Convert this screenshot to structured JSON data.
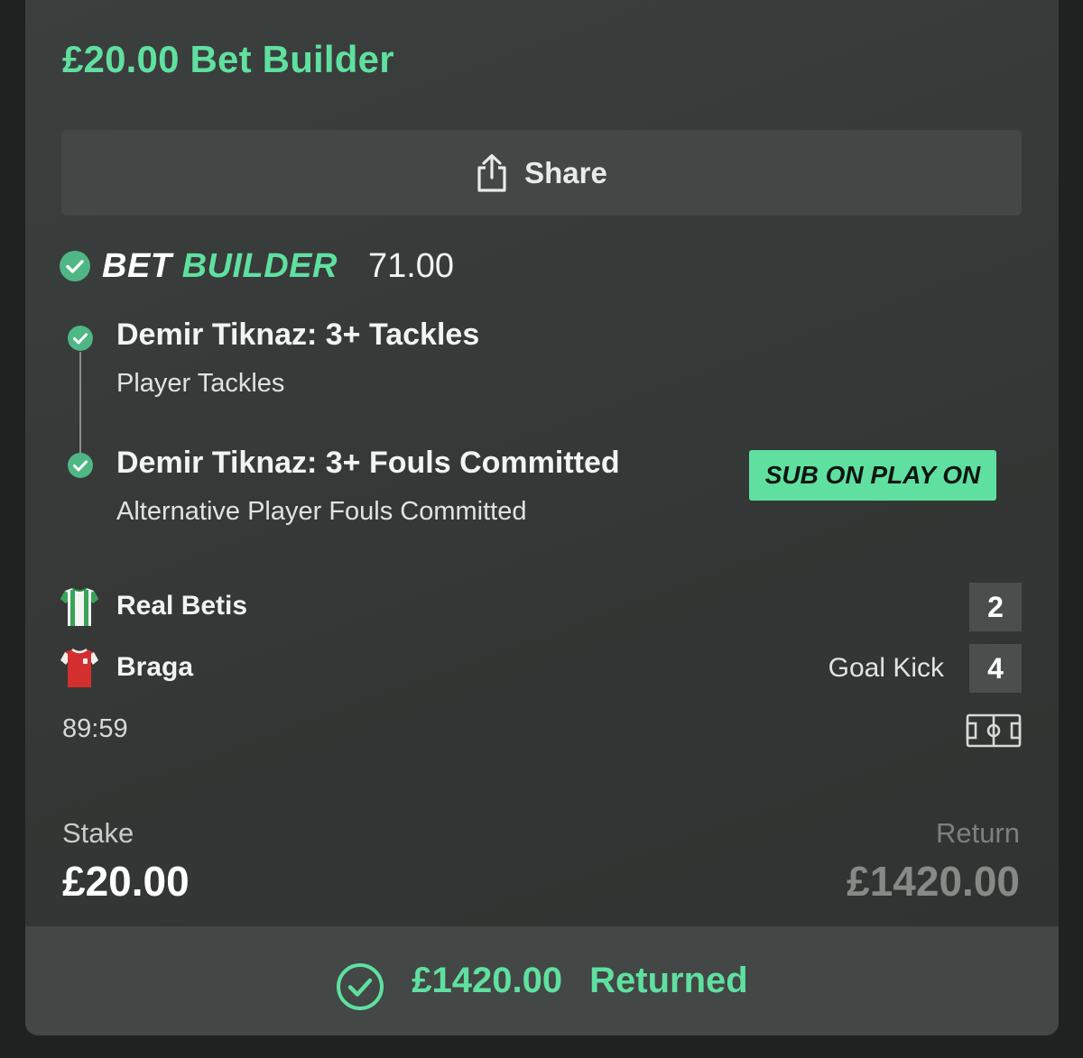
{
  "bet": {
    "title": "£20.00 Bet Builder",
    "share_label": "Share",
    "builder_logo_part1": "BET",
    "builder_logo_part2": "BUILDER",
    "odds": "71.00",
    "promo_badge": "SUB ON PLAY ON"
  },
  "legs": [
    {
      "title": "Demir Tiknaz: 3+ Tackles",
      "market": "Player Tackles"
    },
    {
      "title": "Demir Tiknaz: 3+ Fouls Committed",
      "market": "Alternative Player Fouls Committed"
    }
  ],
  "match": {
    "home": {
      "name": "Real Betis",
      "score": "2",
      "shirt_icon": "green-white-striped-shirt-icon"
    },
    "away": {
      "name": "Braga",
      "score": "4",
      "shirt_icon": "red-shirt-icon",
      "event": "Goal Kick"
    },
    "clock": "89:59"
  },
  "summary": {
    "stake_label": "Stake",
    "stake_value": "£20.00",
    "return_label": "Return",
    "return_value": "£1420.00"
  },
  "footer": {
    "amount": "£1420.00",
    "status": "Returned"
  },
  "colors": {
    "accent": "#5fe0a0",
    "card": "#3b3f3d",
    "panel": "#434745"
  }
}
